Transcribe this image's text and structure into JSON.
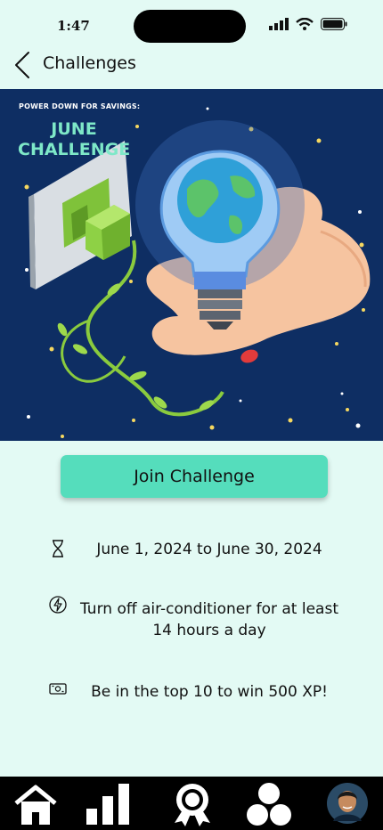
{
  "status": {
    "time": "1:47"
  },
  "header": {
    "title": "Challenges"
  },
  "hero": {
    "tagline": "POWER DOWN FOR SAVINGS:",
    "line1": "JUNE",
    "line2": "CHALLENGE"
  },
  "join": {
    "label": "Join Challenge"
  },
  "details": {
    "dates": "June 1, 2024 to June 30, 2024",
    "task": "Turn off air-conditioner for at least 14 hours a day",
    "reward": "Be in the top 10 to win 500 XP!"
  },
  "nav": {
    "items": [
      "home-icon",
      "leaderboard-icon",
      "badge-icon",
      "community-icon",
      "profile-avatar"
    ]
  }
}
